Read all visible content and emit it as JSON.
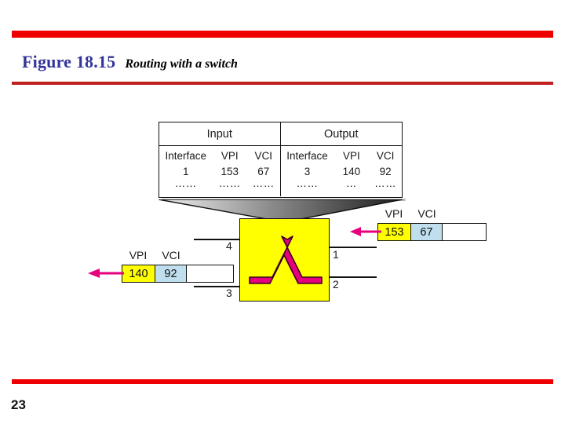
{
  "slide": {
    "page_number": "23",
    "accent_color": "#ee0000",
    "title_color": "#333399",
    "figure_number": "Figure 18.15",
    "figure_caption": "Routing with a switch"
  },
  "routing_table": {
    "group_headers": [
      "Input",
      "Output"
    ],
    "column_headers": [
      "Interface",
      "VPI",
      "VCI",
      "Interface",
      "VPI",
      "VCI"
    ],
    "rows": [
      [
        "1",
        "153",
        "67",
        "3",
        "140",
        "92"
      ],
      [
        "……",
        "……",
        "……",
        "……",
        "…",
        "……"
      ]
    ]
  },
  "switch": {
    "fill_color": "#ffff00",
    "glyph_color": "#e6007e",
    "glyph_name": "crossbar-switch-symbol",
    "interfaces": [
      {
        "label": "4",
        "side": "left",
        "position": "top"
      },
      {
        "label": "3",
        "side": "left",
        "position": "bottom"
      },
      {
        "label": "1",
        "side": "right",
        "position": "top"
      },
      {
        "label": "2",
        "side": "right",
        "position": "bottom"
      }
    ]
  },
  "packets": {
    "incoming": {
      "headers": [
        "VPI",
        "VCI"
      ],
      "vpi": "153",
      "vci": "67",
      "vpi_color": "#ffff00",
      "vci_color": "#bfdeee",
      "arrow_color": "#e6007e",
      "direction": "left"
    },
    "outgoing": {
      "headers": [
        "VPI",
        "VCI"
      ],
      "vpi": "140",
      "vci": "92",
      "vpi_color": "#ffff00",
      "vci_color": "#bfdeee",
      "arrow_color": "#e6007e",
      "direction": "left"
    }
  }
}
